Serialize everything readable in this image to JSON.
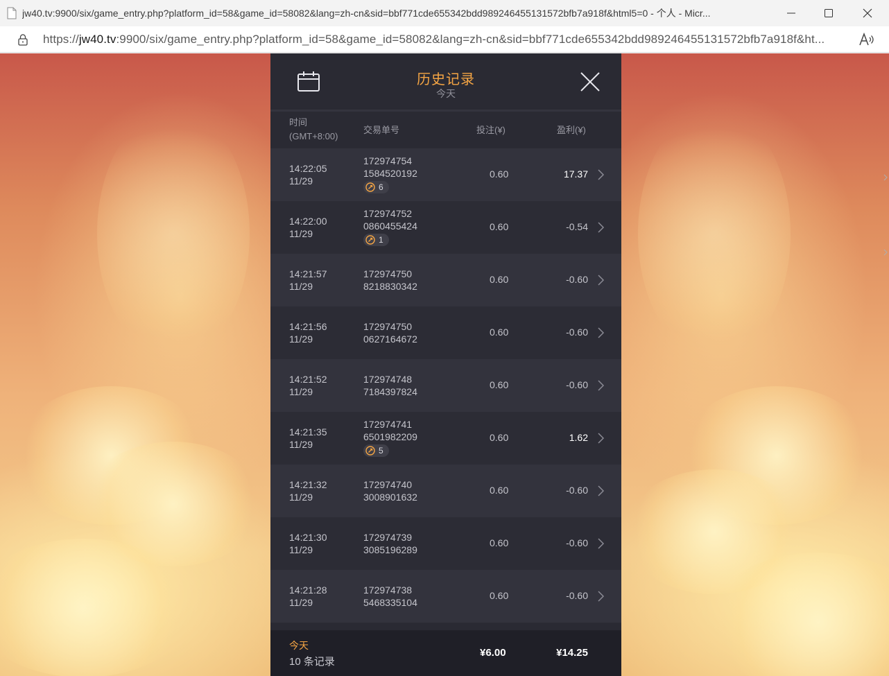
{
  "browser": {
    "window_title": "jw40.tv:9900/six/game_entry.php?platform_id=58&game_id=58082&lang=zh-cn&sid=bbf771cde655342bdd989246455131572bfb7a918f&html5=0 - 个人 - Micr...",
    "url_prefix": "https://",
    "url_host": "jw40.tv",
    "url_rest": ":9900/six/game_entry.php?platform_id=58&game_id=58082&lang=zh-cn&sid=bbf771cde655342bdd989246455131572bfb7a918f&ht..."
  },
  "panel": {
    "title": "历史记录",
    "subtitle": "今天",
    "columns": {
      "time": "时间",
      "timezone": "(GMT+8:00)",
      "order": "交易单号",
      "bet": "投注(¥)",
      "profit": "盈利(¥)"
    },
    "rows": [
      {
        "time": "14:22:05",
        "date": "11/29",
        "order_a": "172974754",
        "order_b": "1584520192",
        "badge": "6",
        "bet": "0.60",
        "profit": "17.37",
        "win": true
      },
      {
        "time": "14:22:00",
        "date": "11/29",
        "order_a": "172974752",
        "order_b": "0860455424",
        "badge": "1",
        "bet": "0.60",
        "profit": "-0.54",
        "win": false
      },
      {
        "time": "14:21:57",
        "date": "11/29",
        "order_a": "172974750",
        "order_b": "8218830342",
        "badge": null,
        "bet": "0.60",
        "profit": "-0.60",
        "win": false
      },
      {
        "time": "14:21:56",
        "date": "11/29",
        "order_a": "172974750",
        "order_b": "0627164672",
        "badge": null,
        "bet": "0.60",
        "profit": "-0.60",
        "win": false
      },
      {
        "time": "14:21:52",
        "date": "11/29",
        "order_a": "172974748",
        "order_b": "7184397824",
        "badge": null,
        "bet": "0.60",
        "profit": "-0.60",
        "win": false
      },
      {
        "time": "14:21:35",
        "date": "11/29",
        "order_a": "172974741",
        "order_b": "6501982209",
        "badge": "5",
        "bet": "0.60",
        "profit": "1.62",
        "win": true
      },
      {
        "time": "14:21:32",
        "date": "11/29",
        "order_a": "172974740",
        "order_b": "3008901632",
        "badge": null,
        "bet": "0.60",
        "profit": "-0.60",
        "win": false
      },
      {
        "time": "14:21:30",
        "date": "11/29",
        "order_a": "172974739",
        "order_b": "3085196289",
        "badge": null,
        "bet": "0.60",
        "profit": "-0.60",
        "win": false
      },
      {
        "time": "14:21:28",
        "date": "11/29",
        "order_a": "172974738",
        "order_b": "5468335104",
        "badge": null,
        "bet": "0.60",
        "profit": "-0.60",
        "win": false
      }
    ],
    "footer": {
      "label": "今天",
      "count": "10 条记录",
      "total_bet": "¥6.00",
      "total_profit": "¥14.25"
    }
  },
  "colors": {
    "accent": "#f5a544",
    "panel_bg": "#2a2a33"
  },
  "icons": [
    "page-icon",
    "lock-icon",
    "read-aloud-icon",
    "minimize-icon",
    "maximize-icon",
    "close-window-icon",
    "calendar-icon",
    "close-icon",
    "chevron-right-icon",
    "free-spin-icon"
  ]
}
